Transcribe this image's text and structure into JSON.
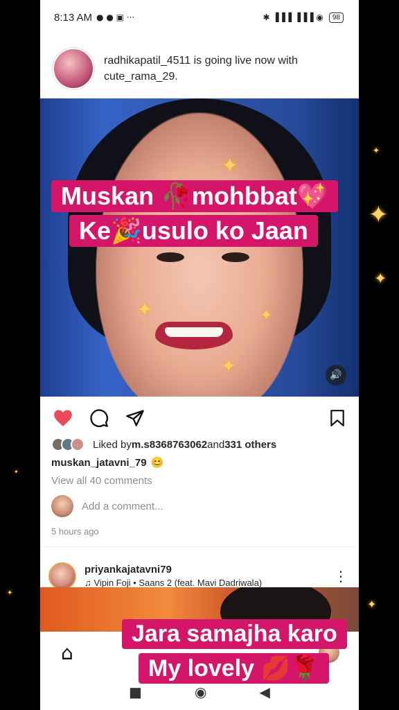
{
  "statusbar": {
    "time": "8:13 AM",
    "left_icons": "● ● ▣  ···",
    "right_icons": "✱ ▐▐▐ ▐▐▐ ◉",
    "battery": "98"
  },
  "live_notice": {
    "text": "radhikapatil_4511 is going live now with cute_rama_29."
  },
  "post1": {
    "caption_line1": "Muskan 🥀mohbbat💖",
    "caption_line2": "Ke🎉usulo ko Jaan",
    "likes_prefix": "Liked by ",
    "likes_user": "m.s8368763062",
    "likes_mid": " and ",
    "likes_count": "331 others",
    "author": "muskan_jatavni_79",
    "author_emoji": "😊",
    "view_comments": "View all 40 comments",
    "comment_placeholder": "Add a comment...",
    "time_ago": "5 hours ago"
  },
  "post2": {
    "username": "priyankajatavni79",
    "song": "Vipin Foji • Saans 2 (feat. Mavi Dadriwala)"
  },
  "overlay": {
    "line1": "Jara samajha karo",
    "line2": "My lovely 💋🌹"
  },
  "icons": {
    "like": "heart-filled-icon",
    "comment": "comment-icon",
    "share": "send-icon",
    "save": "bookmark-icon",
    "sound": "speaker-icon",
    "home": "home-icon",
    "menu": "more-vertical-icon",
    "music": "music-note-icon"
  },
  "colors": {
    "like": "#ed4956",
    "caption_bg": "#d4156a",
    "muted_text": "#8e8e8e"
  }
}
